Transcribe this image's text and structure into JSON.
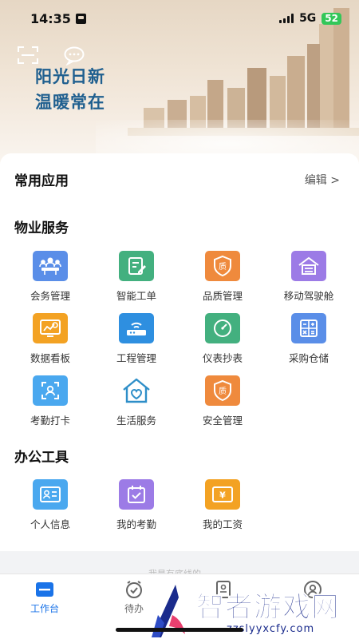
{
  "status_bar": {
    "time": "14:35",
    "network": "5G",
    "battery": "52"
  },
  "banner": {
    "line1": "阳光日新",
    "line2": "温暖常在"
  },
  "common_apps": {
    "title": "常用应用",
    "edit": "编辑 >"
  },
  "property_services": {
    "title": "物业服务",
    "items": [
      {
        "label": "会务管理",
        "icon": "meeting-icon",
        "color": "#5a8ee8"
      },
      {
        "label": "智能工单",
        "icon": "work-order-icon",
        "color": "#43b07f"
      },
      {
        "label": "品质管理",
        "icon": "quality-shield-icon",
        "color": "#ef8a3d"
      },
      {
        "label": "移动驾驶舱",
        "icon": "cockpit-house-icon",
        "color": "#9c7be6"
      },
      {
        "label": "数据看板",
        "icon": "dashboard-icon",
        "color": "#f3a223"
      },
      {
        "label": "工程管理",
        "icon": "router-icon",
        "color": "#2e8fe0"
      },
      {
        "label": "仪表抄表",
        "icon": "gauge-icon",
        "color": "#43b07f"
      },
      {
        "label": "采购仓储",
        "icon": "calculator-icon",
        "color": "#5a8ee8"
      },
      {
        "label": "考勤打卡",
        "icon": "face-scan-icon",
        "color": "#4aa8ef"
      },
      {
        "label": "生活服务",
        "icon": "house-heart-icon",
        "color": "#2d8ec8"
      },
      {
        "label": "安全管理",
        "icon": "safety-shield-icon",
        "color": "#ef8a3d"
      }
    ]
  },
  "office_tools": {
    "title": "办公工具",
    "items": [
      {
        "label": "个人信息",
        "icon": "id-card-icon",
        "color": "#4aa8ef"
      },
      {
        "label": "我的考勤",
        "icon": "calendar-check-icon",
        "color": "#9c7be6"
      },
      {
        "label": "我的工资",
        "icon": "yen-icon",
        "color": "#f3a223"
      }
    ]
  },
  "peek_text": "我是有底线的",
  "tabbar": {
    "items": [
      {
        "label": "工作台",
        "icon": "workbench-icon",
        "active": true
      },
      {
        "label": "待办",
        "icon": "todo-clock-icon",
        "active": false
      },
      {
        "label": "",
        "icon": "document-icon",
        "active": false
      },
      {
        "label": "",
        "icon": "profile-icon",
        "active": false
      }
    ]
  },
  "watermark": {
    "name": "智者游戏网",
    "url": "zzslyyxcfy.com"
  }
}
